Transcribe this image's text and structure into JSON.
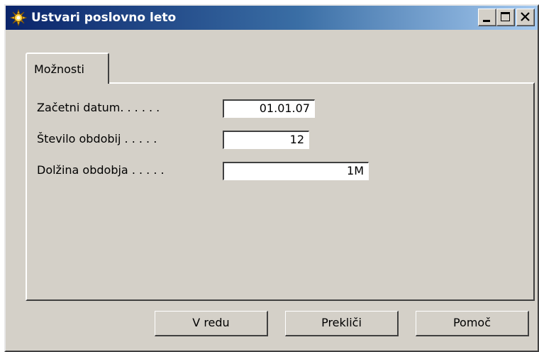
{
  "window": {
    "title": "Ustvari poslovno leto",
    "icon": "gear-sun-icon",
    "controls": [
      "minimize-icon",
      "maximize-icon",
      "close-icon"
    ]
  },
  "tabs": [
    {
      "label": "Možnosti",
      "selected": true
    }
  ],
  "fields": [
    {
      "label": "Začetni datum. . . . . .",
      "value": "01.01.07"
    },
    {
      "label": "Število obdobij  . . . . .",
      "value": "12"
    },
    {
      "label": "Dolžina obdobja . . . . .",
      "value": "1M"
    }
  ],
  "buttons": {
    "ok": "V redu",
    "cancel": "Prekliči",
    "help": "Pomoč"
  },
  "colors": {
    "titlebar_start": "#0a246a",
    "titlebar_end": "#a6caf0",
    "face": "#d4d0c8"
  }
}
